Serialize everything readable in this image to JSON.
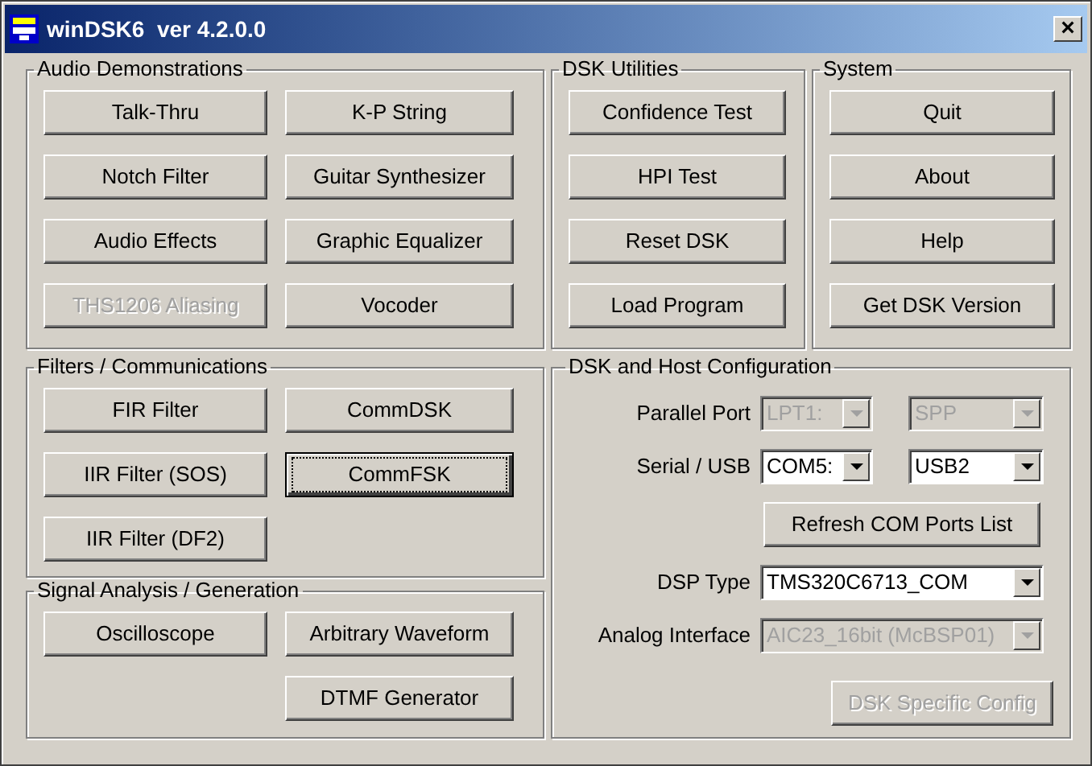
{
  "window": {
    "title": "winDSK6  ver 4.2.0.0",
    "close": "×"
  },
  "top_groups": [
    {
      "title": "Audio Demonstrations",
      "columns": [
        [
          {
            "label": "Talk-Thru",
            "disabled": false,
            "focused": false
          },
          {
            "label": "Notch Filter",
            "disabled": false,
            "focused": false
          },
          {
            "label": "Audio Effects",
            "disabled": false,
            "focused": false
          },
          {
            "label": "THS1206 Aliasing",
            "disabled": true,
            "focused": false
          }
        ],
        [
          {
            "label": "K-P String",
            "disabled": false,
            "focused": false
          },
          {
            "label": "Guitar Synthesizer",
            "disabled": false,
            "focused": false
          },
          {
            "label": "Graphic Equalizer",
            "disabled": false,
            "focused": false
          },
          {
            "label": "Vocoder",
            "disabled": false,
            "focused": false
          }
        ]
      ]
    },
    {
      "title": "DSK Utilities",
      "columns": [
        [
          {
            "label": "Confidence Test",
            "disabled": false,
            "focused": false
          },
          {
            "label": "HPI Test",
            "disabled": false,
            "focused": false
          },
          {
            "label": "Reset DSK",
            "disabled": false,
            "focused": false
          },
          {
            "label": "Load Program",
            "disabled": false,
            "focused": false
          }
        ]
      ]
    },
    {
      "title": "System",
      "columns": [
        [
          {
            "label": "Quit",
            "disabled": false,
            "focused": false
          },
          {
            "label": "About",
            "disabled": false,
            "focused": false
          },
          {
            "label": "Help",
            "disabled": false,
            "focused": false
          },
          {
            "label": "Get DSK Version",
            "disabled": false,
            "focused": false
          }
        ]
      ]
    }
  ],
  "left_groups": [
    {
      "title": "Filters / Communications",
      "columns": [
        [
          {
            "label": "FIR Filter",
            "disabled": false,
            "focused": false
          },
          {
            "label": "IIR Filter (SOS)",
            "disabled": false,
            "focused": false
          },
          {
            "label": "IIR Filter (DF2)",
            "disabled": false,
            "focused": false
          }
        ],
        [
          {
            "label": "CommDSK",
            "disabled": false,
            "focused": false
          },
          {
            "label": "CommFSK",
            "disabled": false,
            "focused": true
          }
        ]
      ]
    },
    {
      "title": "Signal Analysis / Generation",
      "columns": [
        [
          {
            "label": "Oscilloscope",
            "disabled": false,
            "focused": false
          }
        ],
        [
          {
            "label": "Arbitrary Waveform",
            "disabled": false,
            "focused": false
          },
          {
            "label": "DTMF Generator",
            "disabled": false,
            "focused": false
          }
        ]
      ]
    }
  ],
  "config": {
    "title": "DSK and Host Configuration",
    "rows": [
      {
        "kind": "combos",
        "label": "Parallel Port",
        "combos": [
          {
            "value": "LPT1:",
            "disabled": true
          },
          {
            "value": "SPP",
            "disabled": true
          }
        ]
      },
      {
        "kind": "combos",
        "label": "Serial / USB",
        "combos": [
          {
            "value": "COM5:",
            "disabled": false
          },
          {
            "value": "USB2",
            "disabled": false
          }
        ]
      },
      {
        "kind": "wide_button",
        "label": "Refresh COM Ports List",
        "disabled": false,
        "focused": false
      },
      {
        "kind": "combos",
        "label": "DSP Type",
        "combos": [
          {
            "value": "TMS320C6713_COM",
            "disabled": false
          }
        ]
      },
      {
        "kind": "combos",
        "label": "Analog Interface",
        "combos": [
          {
            "value": "AIC23_16bit (McBSP01)",
            "disabled": true
          }
        ]
      },
      {
        "kind": "button",
        "label": "DSK Specific Config",
        "disabled": true,
        "focused": false
      }
    ]
  }
}
